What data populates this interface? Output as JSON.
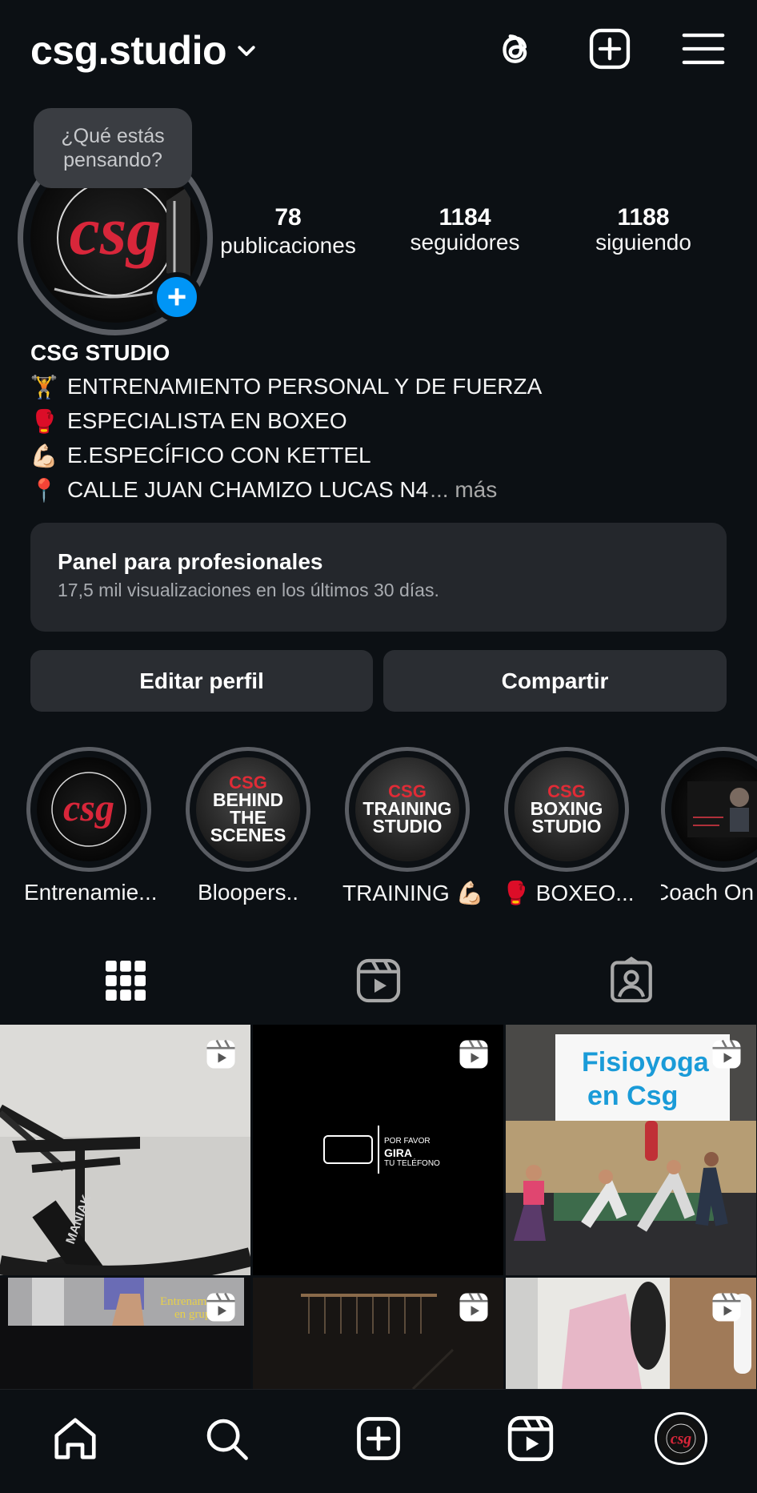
{
  "header": {
    "username": "csg.studio"
  },
  "composer_bubble": "¿Qué estás pensando?",
  "stats": [
    {
      "value": "78",
      "label": "publicaciones"
    },
    {
      "value": "1184",
      "label": "seguidores"
    },
    {
      "value": "1188",
      "label": "siguiendo"
    }
  ],
  "bio": {
    "name": "CSG STUDIO",
    "lines": [
      {
        "emoji": "🏋️",
        "text": "ENTRENAMIENTO PERSONAL Y DE FUERZA"
      },
      {
        "emoji": "🥊",
        "text": "ESPECIALISTA EN BOXEO"
      },
      {
        "emoji": "💪🏻",
        "text": "E.ESPECÍFICO CON KETTEL"
      },
      {
        "emoji": "📍",
        "text": "CALLE JUAN CHAMIZO LUCAS N4"
      }
    ],
    "more": "... más"
  },
  "panel": {
    "title": "Panel para profesionales",
    "subtitle": "17,5 mil visualizaciones en los últimos 30 días."
  },
  "buttons": {
    "edit": "Editar perfil",
    "share": "Compartir"
  },
  "highlights": [
    {
      "label": "Entrenamie..."
    },
    {
      "label": "Bloopers.."
    },
    {
      "label": "TRAINING 💪🏻"
    },
    {
      "label": "🥊 BOXEO..."
    },
    {
      "label": "Coach On"
    }
  ],
  "highlight_art": {
    "logo": "csg",
    "bts_brand": "CSG",
    "bts_text": [
      "BEHIND",
      "THE",
      "SCENES"
    ],
    "training_brand": "CSG",
    "training_text": [
      "TRAINING",
      "STUDIO"
    ],
    "boxing_brand": "CSG",
    "boxing_text": [
      "BOXING",
      "STUDIO"
    ]
  },
  "posts": {
    "treadmill_brand": "MANIAK",
    "rotate_text": [
      "POR FAVOR",
      "GIRA",
      "TU TELÉFONO"
    ],
    "fisioyoga_title": [
      "Fisioyoga",
      "en Csg"
    ],
    "entrenamiento_text": [
      "Entrenamiento",
      "en grupo"
    ]
  },
  "colors": {
    "background": "#0c1014",
    "accent_blue": "#0095f6",
    "surface": "#24272c",
    "brand_red": "#e02b36"
  }
}
